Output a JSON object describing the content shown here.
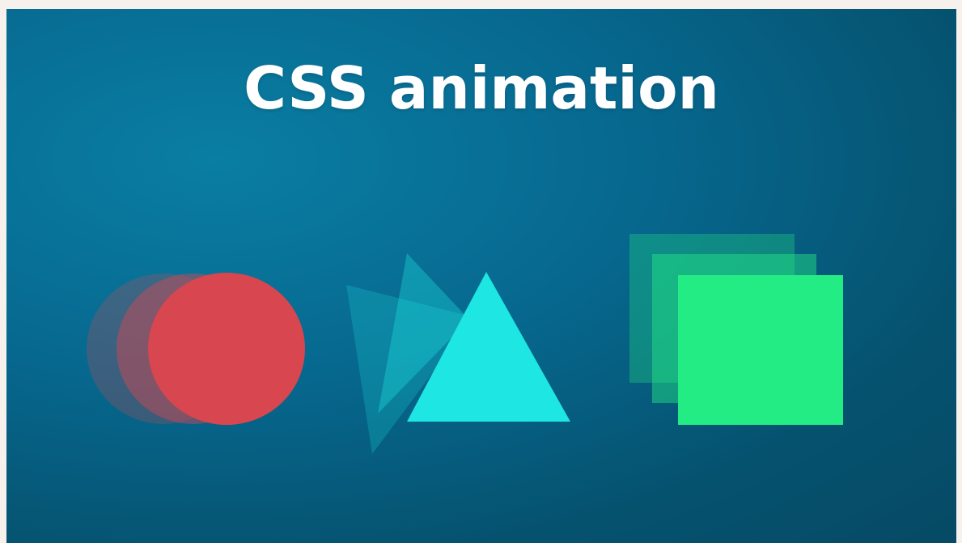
{
  "title": "CSS animation",
  "colors": {
    "circle": "#d8464f",
    "triangle": "#1de6e3",
    "square": "#23ec84"
  },
  "icons": [
    "animated-circle-icon",
    "animated-triangle-icon",
    "animated-square-icon"
  ]
}
